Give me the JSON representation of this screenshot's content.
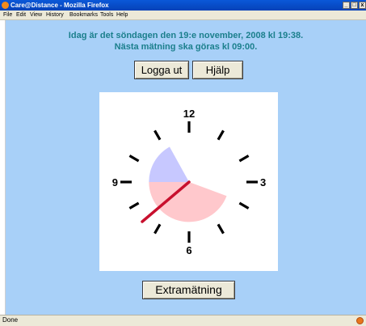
{
  "window": {
    "title": "Care@Distance - Mozilla Firefox",
    "min": "_",
    "max": "□",
    "close": "x"
  },
  "menu": [
    "File",
    "Edit",
    "View",
    "History",
    "Bookmarks",
    "Tools",
    "Help"
  ],
  "header": {
    "line1": "Idag är det söndagen den 19:e november, 2008 kl 19:38.",
    "line2": "Nästa mätning ska göras kl 09:00."
  },
  "buttons": {
    "logout": "Logga ut",
    "help": "Hjälp",
    "extra": "Extramätning"
  },
  "clock": {
    "numerals": {
      "n12": "12",
      "n3": "3",
      "n6": "6",
      "n9": "9"
    },
    "time": "19:38",
    "colors": {
      "upper_sector": "#c7c8ff",
      "lower_sector": "#ffc8cc",
      "hand": "#c8102e"
    }
  },
  "status": {
    "text": "Done"
  }
}
